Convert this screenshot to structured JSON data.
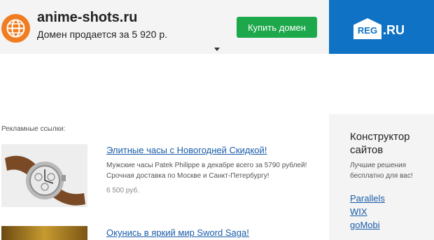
{
  "header": {
    "domain": "anime-shots.ru",
    "sale_text": "Домен продается за 5 920 р.",
    "buy_button": "Купить домен",
    "registrar_logo_mark": "REG",
    "registrar_logo_suffix": ".RU",
    "icons": {
      "globe": "globe-icon",
      "caret": "caret-down-icon"
    },
    "colors": {
      "buy": "#1ea84c",
      "registrar": "#0f72c4",
      "globe": "#f07d22"
    }
  },
  "ads": {
    "label": "Рекламные ссылки:",
    "items": [
      {
        "title": "Элитные часы с Новогодней Скидкой!",
        "description": "Мужские часы Patek Philippe в декабре всего за 5790 рублей! Срочная доставка по Москве и Санкт-Петербургу!",
        "price": "6 500 руб."
      },
      {
        "title": "Окунись в яркий мир Sword Saga!"
      }
    ]
  },
  "sidebar": {
    "title": "Конструктор сайтов",
    "subtitle": "Лучшие решения бесплатно для вас!",
    "links": [
      "Parallels",
      "WIX",
      "goMobi"
    ]
  }
}
